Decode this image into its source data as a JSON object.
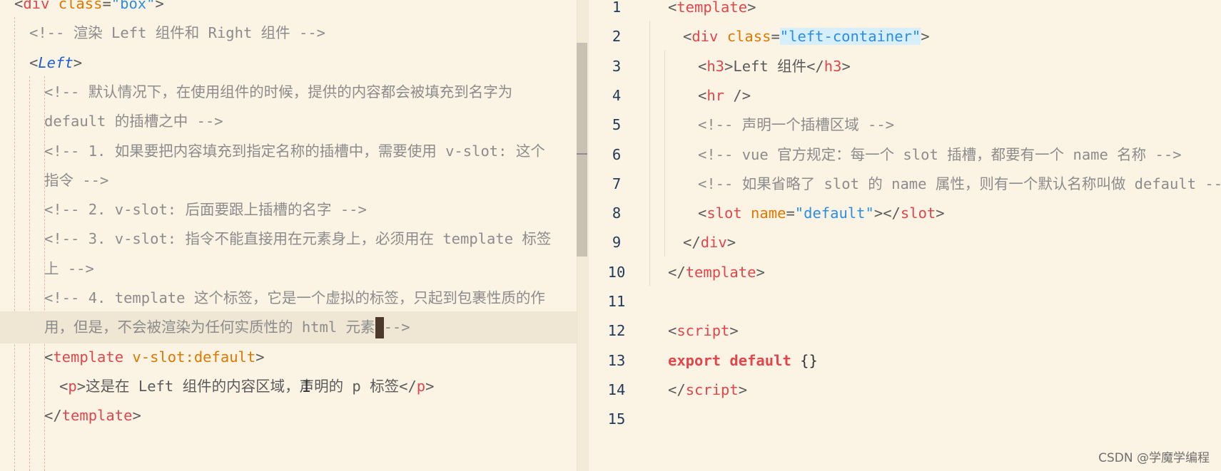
{
  "left_editor": {
    "lines": [
      {
        "id": "l0",
        "indent": 0,
        "parts": [
          [
            "p",
            "<"
          ],
          [
            "tag",
            "div"
          ],
          [
            "attr",
            " class"
          ],
          [
            "p",
            "="
          ],
          [
            "str",
            "\"box\""
          ],
          [
            "p",
            ">"
          ]
        ]
      },
      {
        "id": "l1",
        "indent": 1,
        "parts": [
          [
            "cm",
            "<!-- 渲染 Left 组件和 Right 组件 -->"
          ]
        ]
      },
      {
        "id": "l2",
        "indent": 1,
        "parts": [
          [
            "p",
            "<"
          ],
          [
            "tag-i",
            "Left"
          ],
          [
            "p",
            ">"
          ]
        ]
      },
      {
        "id": "l3",
        "indent": 2,
        "parts": [
          [
            "cm",
            "<!-- 默认情况下，在使用组件的时候，提供的内容都会被填充到名字为"
          ]
        ]
      },
      {
        "id": "l4",
        "indent": 2,
        "parts": [
          [
            "cm",
            "default 的插槽之中 -->"
          ]
        ]
      },
      {
        "id": "l5",
        "indent": 2,
        "parts": [
          [
            "cm",
            "<!-- 1. 如果要把内容填充到指定名称的插槽中，需要使用 v-slot: 这个"
          ]
        ]
      },
      {
        "id": "l6",
        "indent": 2,
        "parts": [
          [
            "cm",
            "指令 -->"
          ]
        ]
      },
      {
        "id": "l7",
        "indent": 2,
        "parts": [
          [
            "cm",
            "<!-- 2. v-slot: 后面要跟上插槽的名字 -->"
          ]
        ]
      },
      {
        "id": "l8",
        "indent": 2,
        "parts": [
          [
            "cm",
            "<!-- 3. v-slot: 指令不能直接用在元素身上，必须用在 template 标签"
          ]
        ]
      },
      {
        "id": "l9",
        "indent": 2,
        "parts": [
          [
            "cm",
            "上 -->"
          ]
        ]
      },
      {
        "id": "l10",
        "indent": 2,
        "parts": [
          [
            "cm",
            "<!-- 4. template 这个标签，它是一个虚拟的标签，只起到包裹性质的作"
          ]
        ]
      },
      {
        "id": "l11",
        "indent": 2,
        "highlight": true,
        "parts": [
          [
            "cm",
            "用，但是，不会被渲染为任何实质性的 html 元素"
          ],
          [
            "cursor",
            ""
          ],
          [
            "cm",
            "-->"
          ]
        ]
      },
      {
        "id": "l12",
        "indent": 2,
        "parts": [
          [
            "p",
            "<"
          ],
          [
            "tag",
            "template"
          ],
          [
            "attr",
            " v-slot:default"
          ],
          [
            "p",
            ">"
          ]
        ]
      },
      {
        "id": "l13",
        "indent": 3,
        "parts": [
          [
            "p",
            "<"
          ],
          [
            "tag",
            "p"
          ],
          [
            "p",
            ">这是在 Left 组件的内容区域，声明的 p 标签</"
          ],
          [
            "tag",
            "p"
          ],
          [
            "p",
            ">"
          ]
        ]
      },
      {
        "id": "l14",
        "indent": 2,
        "parts": [
          [
            "p",
            "</"
          ],
          [
            "tag",
            "template"
          ],
          [
            "p",
            ">"
          ]
        ]
      }
    ]
  },
  "right_editor": {
    "lines": [
      {
        "num": "1",
        "indent": 0,
        "parts": [
          [
            "p",
            "<"
          ],
          [
            "tag",
            "template"
          ],
          [
            "p",
            ">"
          ]
        ]
      },
      {
        "num": "2",
        "indent": 1,
        "parts": [
          [
            "p",
            "<"
          ],
          [
            "tag",
            "div"
          ],
          [
            "attr",
            " class"
          ],
          [
            "p",
            "="
          ],
          [
            "str-hl",
            "\"left-container\""
          ],
          [
            "p",
            ">"
          ]
        ]
      },
      {
        "num": "3",
        "indent": 2,
        "parts": [
          [
            "p",
            "<"
          ],
          [
            "tag",
            "h3"
          ],
          [
            "p",
            ">Left 组件</"
          ],
          [
            "tag",
            "h3"
          ],
          [
            "p",
            ">"
          ]
        ]
      },
      {
        "num": "4",
        "indent": 2,
        "parts": [
          [
            "p",
            "<"
          ],
          [
            "tag",
            "hr"
          ],
          [
            "p",
            " />"
          ]
        ]
      },
      {
        "num": "5",
        "indent": 2,
        "parts": [
          [
            "cm",
            "<!-- 声明一个插槽区域 -->"
          ]
        ]
      },
      {
        "num": "6",
        "indent": 2,
        "parts": [
          [
            "cm",
            "<!-- vue 官方规定：每一个 slot 插槽，都要有一个 name 名称 -->"
          ]
        ]
      },
      {
        "num": "7",
        "indent": 2,
        "parts": [
          [
            "cm",
            "<!-- 如果省略了 slot 的 name 属性，则有一个默认名称叫做 default -->"
          ]
        ]
      },
      {
        "num": "8",
        "indent": 2,
        "parts": [
          [
            "p",
            "<"
          ],
          [
            "tag",
            "slot"
          ],
          [
            "attr",
            " name"
          ],
          [
            "p",
            "="
          ],
          [
            "str",
            "\"default\""
          ],
          [
            "p",
            "></"
          ],
          [
            "tag",
            "slot"
          ],
          [
            "p",
            ">"
          ]
        ]
      },
      {
        "num": "9",
        "indent": 1,
        "parts": [
          [
            "p",
            "</"
          ],
          [
            "tag",
            "div"
          ],
          [
            "p",
            ">"
          ]
        ]
      },
      {
        "num": "10",
        "indent": 0,
        "parts": [
          [
            "p",
            "</"
          ],
          [
            "tag",
            "template"
          ],
          [
            "p",
            ">"
          ]
        ]
      },
      {
        "num": "11",
        "indent": 0,
        "parts": []
      },
      {
        "num": "12",
        "indent": 0,
        "parts": [
          [
            "p",
            "<"
          ],
          [
            "tag",
            "script"
          ],
          [
            "p",
            ">"
          ]
        ]
      },
      {
        "num": "13",
        "indent": 0,
        "parts": [
          [
            "kw",
            "export default"
          ],
          [
            "brace",
            " {}"
          ]
        ]
      },
      {
        "num": "14",
        "indent": 0,
        "parts": [
          [
            "p",
            "</"
          ],
          [
            "tag",
            "script"
          ],
          [
            "p",
            ">"
          ]
        ]
      },
      {
        "num": "15",
        "indent": 0,
        "parts": []
      }
    ]
  },
  "watermark": "CSDN @学魔学编程"
}
